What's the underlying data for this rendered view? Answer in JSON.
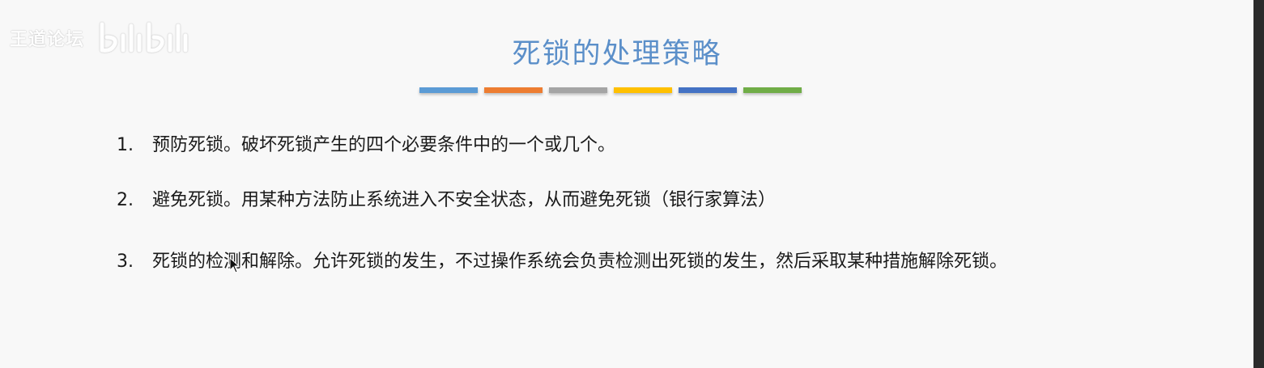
{
  "watermark": {
    "text": "王道论坛",
    "logo_label": "bilibili"
  },
  "slide": {
    "title": "死锁的处理策略",
    "bar_colors": [
      "#5b9bd5",
      "#ed7d31",
      "#a5a5a5",
      "#ffc000",
      "#4472c4",
      "#70ad47"
    ],
    "items": [
      {
        "number": "1.",
        "text": "预防死锁。破坏死锁产生的四个必要条件中的一个或几个。"
      },
      {
        "number": "2.",
        "text": "避免死锁。用某种方法防止系统进入不安全状态，从而避免死锁（银行家算法）"
      },
      {
        "number": "3.",
        "text": "死锁的检测和解除。允许死锁的发生，不过操作系统会负责检测出死锁的发生，然后采取某种措施解除死锁。"
      }
    ]
  },
  "colors": {
    "title": "#5b8fc9",
    "body_text": "#1a1a1a",
    "background": "#f8f8f8"
  }
}
